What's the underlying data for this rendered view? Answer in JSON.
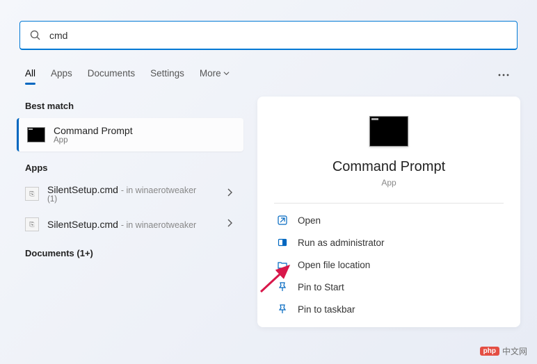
{
  "search": {
    "value": "cmd"
  },
  "tabs": {
    "items": [
      "All",
      "Apps",
      "Documents",
      "Settings",
      "More"
    ],
    "active": "All"
  },
  "sections": {
    "best_match": {
      "title": "Best match",
      "item": {
        "title": "Command Prompt",
        "sub": "App"
      }
    },
    "apps": {
      "title": "Apps",
      "items": [
        {
          "title": "SilentSetup.cmd",
          "meta": "- in winaerotweaker",
          "sub": "(1)"
        },
        {
          "title": "SilentSetup.cmd",
          "meta": "- in winaerotweaker",
          "sub": ""
        }
      ]
    },
    "documents": {
      "title": "Documents (1+)"
    }
  },
  "preview": {
    "title": "Command Prompt",
    "sub": "App",
    "actions": [
      "Open",
      "Run as administrator",
      "Open file location",
      "Pin to Start",
      "Pin to taskbar"
    ]
  },
  "watermark": {
    "badge": "php",
    "text": "中文网"
  }
}
